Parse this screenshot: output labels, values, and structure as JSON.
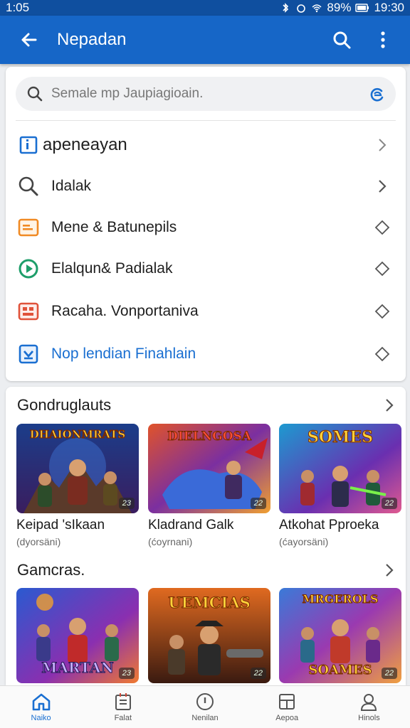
{
  "status_bar": {
    "time_left": "1:05",
    "battery": "89%",
    "time_right": "19:30"
  },
  "app_bar": {
    "title": "Nepadan"
  },
  "search": {
    "placeholder": "Semale mp Jaupiagioain."
  },
  "menu": {
    "header": "apeneayan",
    "items": [
      {
        "label": "Idalak",
        "icon": "search-icon",
        "color": "#444444"
      },
      {
        "label": "Mene & Batunepils",
        "icon": "card-icon",
        "color": "#f08a24"
      },
      {
        "label": "Elalqun& Padialak",
        "icon": "play-circle-icon",
        "color": "#1e9e6a"
      },
      {
        "label": "Racaha. Vonportaniva",
        "icon": "grid-icon",
        "color": "#e0523a"
      },
      {
        "label": "Nop lendian Finahlain",
        "icon": "download-icon",
        "color": "#1a6fd1"
      }
    ]
  },
  "section1": {
    "title": "Gondruglauts",
    "tiles": [
      {
        "name": "Keipad 'sIkaan",
        "sub": "(dyorsäni)",
        "badge": "23",
        "art_text": "DHAIONMRATS",
        "theme": "blue"
      },
      {
        "name": "Kladrand Galk",
        "sub": "(ćoyrnani)",
        "badge": "22",
        "art_text": "DIELNGOSA",
        "theme": "purple"
      },
      {
        "name": "Atkohat Pproeka",
        "sub": "(ćayorsäni)",
        "badge": "22",
        "art_text": "SOMES",
        "theme": "teal"
      }
    ]
  },
  "section2": {
    "title": "Gamcras.",
    "tiles": [
      {
        "badge": "23",
        "art_text": "MARTAN",
        "theme": "blue"
      },
      {
        "badge": "22",
        "art_text": "UEMCIAS",
        "theme": "brown"
      },
      {
        "badge": "22",
        "art_text": "SOAMES",
        "theme": "purple"
      }
    ]
  },
  "bottom_nav": [
    {
      "label": "Naiko",
      "icon": "home-icon"
    },
    {
      "label": "Falat",
      "icon": "list-icon"
    },
    {
      "label": "Nenilan",
      "icon": "info-icon"
    },
    {
      "label": "Aepoa",
      "icon": "apps-icon"
    },
    {
      "label": "Hinols",
      "icon": "profile-icon"
    }
  ],
  "colors": {
    "primary": "#1666c7",
    "status": "#0f4f9f",
    "link": "#1a6fd1"
  }
}
